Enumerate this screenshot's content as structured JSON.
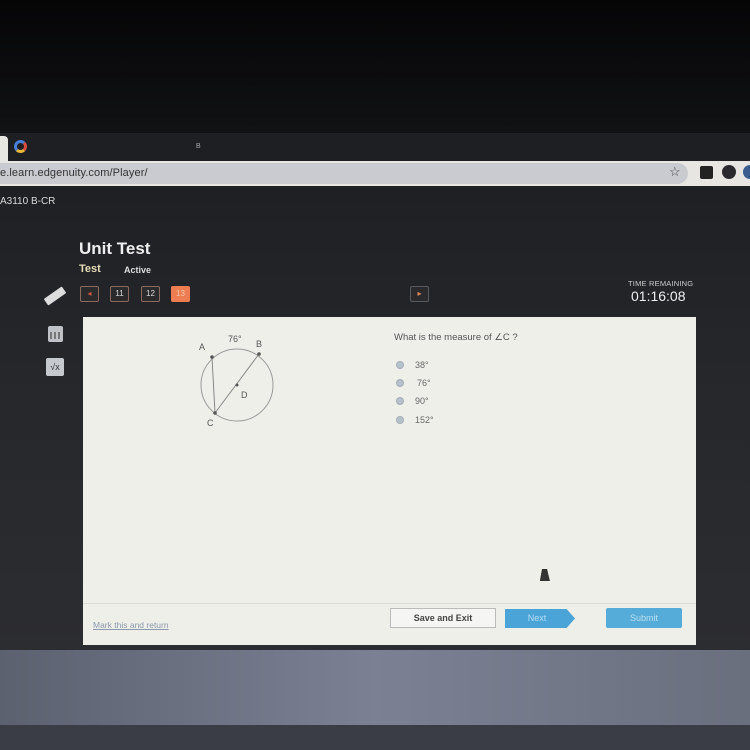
{
  "browser": {
    "tab_indicator": "B",
    "url": "e.learn.edgenuity.com/Player/"
  },
  "header": {
    "course_code": "A3110 B-CR",
    "title": "Unit Test",
    "type_label": "Test",
    "status_label": "Active",
    "nav": {
      "prev_arrow": "◂",
      "next_arrow": "▸",
      "questions": [
        "11",
        "12",
        "13"
      ],
      "current": "13"
    },
    "timer": {
      "label": "TIME REMAINING",
      "value": "01:16:08"
    }
  },
  "tools": {
    "formula_label": "√x"
  },
  "question": {
    "diagram": {
      "arc_label": "76°",
      "points": [
        "A",
        "B",
        "C",
        "D"
      ]
    },
    "prompt": "What is the measure of  ∠C ?",
    "choices": [
      "38°",
      "76°",
      "90°",
      "152°"
    ]
  },
  "footer": {
    "mark_link": "Mark this and return",
    "save_exit": "Save and Exit",
    "next": "Next",
    "submit": "Submit"
  },
  "colors": {
    "accent_orange": "#ee7d51",
    "accent_blue": "#4aa4d8"
  }
}
